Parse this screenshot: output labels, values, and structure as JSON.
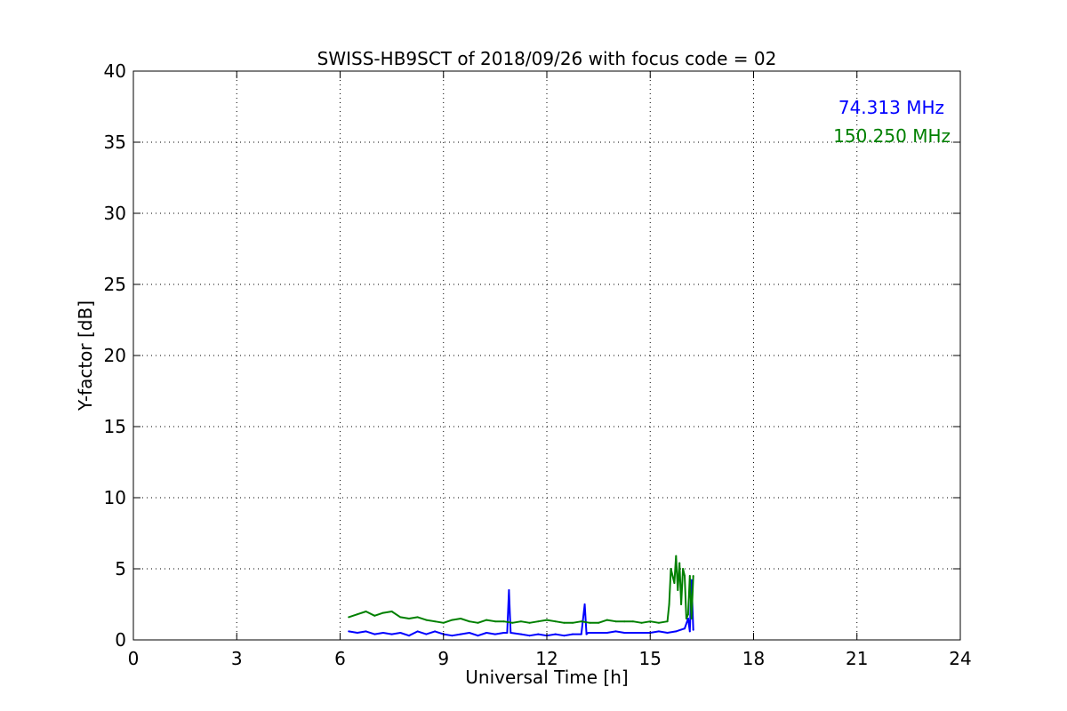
{
  "chart_data": {
    "type": "line",
    "title": "SWISS-HB9SCT of 2018/09/26 with focus code = 02",
    "xlabel": "Universal Time [h]",
    "ylabel": "Y-factor [dB]",
    "xlim": [
      0,
      24
    ],
    "ylim": [
      0,
      40
    ],
    "xticks": [
      0,
      3,
      6,
      9,
      12,
      15,
      18,
      21,
      24
    ],
    "yticks": [
      0,
      5,
      10,
      15,
      20,
      25,
      30,
      35,
      40
    ],
    "grid": true,
    "legend_position": "top-right",
    "series": [
      {
        "name": "74.313 MHz",
        "color": "#0000ff",
        "x": [
          6.25,
          6.5,
          6.75,
          7.0,
          7.25,
          7.5,
          7.75,
          8.0,
          8.25,
          8.5,
          8.75,
          9.0,
          9.25,
          9.5,
          9.75,
          10.0,
          10.25,
          10.5,
          10.75,
          10.85,
          10.9,
          10.95,
          11.25,
          11.5,
          11.75,
          12.0,
          12.25,
          12.5,
          12.75,
          13.0,
          13.1,
          13.15,
          13.2,
          13.5,
          13.75,
          14.0,
          14.25,
          14.5,
          14.75,
          15.0,
          15.25,
          15.5,
          15.75,
          16.0,
          16.1,
          16.15,
          16.2,
          16.25
        ],
        "y": [
          0.6,
          0.5,
          0.6,
          0.4,
          0.5,
          0.4,
          0.5,
          0.3,
          0.6,
          0.4,
          0.6,
          0.4,
          0.3,
          0.4,
          0.5,
          0.3,
          0.5,
          0.4,
          0.5,
          0.5,
          3.5,
          0.5,
          0.4,
          0.3,
          0.4,
          0.3,
          0.4,
          0.3,
          0.4,
          0.4,
          2.5,
          0.4,
          0.5,
          0.5,
          0.5,
          0.6,
          0.5,
          0.5,
          0.5,
          0.5,
          0.6,
          0.5,
          0.6,
          0.8,
          1.5,
          0.6,
          4.2,
          0.7
        ]
      },
      {
        "name": "150.250 MHz",
        "color": "#008000",
        "x": [
          6.25,
          6.5,
          6.75,
          7.0,
          7.25,
          7.5,
          7.75,
          8.0,
          8.25,
          8.5,
          8.75,
          9.0,
          9.25,
          9.5,
          9.75,
          10.0,
          10.25,
          10.5,
          10.75,
          11.0,
          11.25,
          11.5,
          11.75,
          12.0,
          12.25,
          12.5,
          12.75,
          13.0,
          13.25,
          13.5,
          13.75,
          14.0,
          14.25,
          14.5,
          14.75,
          15.0,
          15.25,
          15.5,
          15.55,
          15.6,
          15.7,
          15.75,
          15.8,
          15.85,
          15.9,
          15.95,
          16.0,
          16.05,
          16.1,
          16.15,
          16.2,
          16.25
        ],
        "y": [
          1.6,
          1.8,
          2.0,
          1.7,
          1.9,
          2.0,
          1.6,
          1.5,
          1.6,
          1.4,
          1.3,
          1.2,
          1.4,
          1.5,
          1.3,
          1.2,
          1.4,
          1.3,
          1.3,
          1.2,
          1.3,
          1.2,
          1.3,
          1.4,
          1.3,
          1.2,
          1.2,
          1.3,
          1.2,
          1.2,
          1.4,
          1.3,
          1.3,
          1.3,
          1.2,
          1.3,
          1.2,
          1.3,
          2.5,
          5.0,
          4.0,
          5.9,
          3.5,
          5.4,
          2.5,
          5.0,
          4.5,
          1.5,
          1.8,
          4.5,
          1.5,
          4.5
        ]
      }
    ]
  }
}
